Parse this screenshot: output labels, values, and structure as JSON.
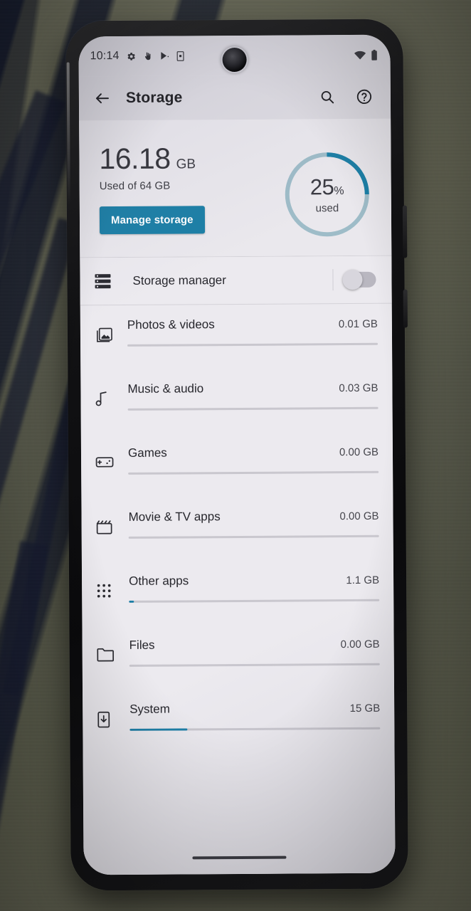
{
  "status_bar": {
    "time": "10:14",
    "left_icons": [
      "gear-icon",
      "touch-hand-icon",
      "play-store-icon",
      "device-icon"
    ],
    "right_icons": [
      "wifi-icon",
      "battery-icon"
    ]
  },
  "app_bar": {
    "back_icon": "back-arrow-icon",
    "title": "Storage",
    "search_icon": "search-icon",
    "help_icon": "help-circle-icon"
  },
  "summary": {
    "used_amount": "16.18",
    "used_unit": "GB",
    "subtitle": "Used of 64 GB",
    "manage_button": "Manage storage",
    "donut_percent": "25",
    "donut_percent_symbol": "%",
    "donut_caption": "used",
    "accent_color": "#1c7fa6",
    "donut_track_color": "#97b9c6"
  },
  "storage_manager": {
    "icon": "storage-manager-list-icon",
    "label": "Storage manager",
    "toggle_state": "off"
  },
  "categories": [
    {
      "icon": "photos-videos-icon",
      "name": "Photos & videos",
      "size": "0.01 GB",
      "bar_percent": 0
    },
    {
      "icon": "music-audio-icon",
      "name": "Music & audio",
      "size": "0.03 GB",
      "bar_percent": 0
    },
    {
      "icon": "games-icon",
      "name": "Games",
      "size": "0.00 GB",
      "bar_percent": 0
    },
    {
      "icon": "movie-tv-icon",
      "name": "Movie & TV apps",
      "size": "0.00 GB",
      "bar_percent": 0
    },
    {
      "icon": "other-apps-icon",
      "name": "Other apps",
      "size": "1.1 GB",
      "bar_percent": 2
    },
    {
      "icon": "files-icon",
      "name": "Files",
      "size": "0.00 GB",
      "bar_percent": 0
    },
    {
      "icon": "system-icon",
      "name": "System",
      "size": "15 GB",
      "bar_percent": 23
    }
  ],
  "navigation": {
    "pill": "gesture-nav-pill"
  }
}
